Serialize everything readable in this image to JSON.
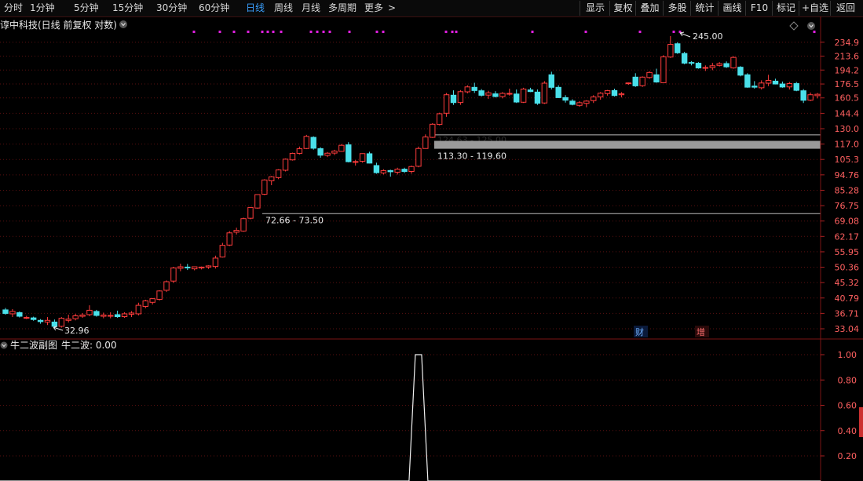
{
  "toolbar": {
    "periods": [
      "分时",
      "1分钟",
      "5分钟",
      "15分钟",
      "30分钟",
      "60分钟",
      "日线",
      "周线",
      "月线",
      "多周期",
      "更多"
    ],
    "active_period": "日线",
    "more_arrow": ">",
    "right_buttons": [
      "显示",
      "复权",
      "叠加",
      "多股",
      "统计",
      "画线",
      "F10",
      "标记",
      "+自选",
      "返回"
    ]
  },
  "main_panel": {
    "title": "谆中科技(日线 前复权 对数)",
    "high_label": "245.00",
    "low_label": "32.96",
    "event_badges": [
      "财",
      "增"
    ],
    "price_ticks": [
      "234.9",
      "213.6",
      "194.2",
      "176.5",
      "160.5",
      "144.4",
      "130.0",
      "117.0",
      "105.3",
      "94.76",
      "85.28",
      "76.75",
      "69.08",
      "62.17",
      "55.95",
      "50.36",
      "45.32",
      "40.79",
      "36.71",
      "33.04"
    ],
    "zones": [
      {
        "label": "124.63 - 125.00"
      },
      {
        "label": "113.30 - 119.60"
      },
      {
        "label": "72.66 - 73.50"
      }
    ]
  },
  "sub_panel": {
    "title": "牛二波副图",
    "indicator_label": "牛二波: 0.00",
    "ticks": [
      "1.00",
      "0.80",
      "0.60",
      "0.40",
      "0.20"
    ]
  },
  "colors": {
    "up": "#ff3c3c",
    "down": "#4ae0ea",
    "grid": "#5a1010",
    "accent": "#3aa0ff",
    "marker": "#e020e0"
  },
  "chart_data": {
    "type": "candlestick",
    "scale": "log",
    "ylim": [
      33.04,
      245.0
    ],
    "candles": [
      [
        37.6,
        38.1,
        36.4,
        36.7
      ],
      [
        36.6,
        37.8,
        35.8,
        37.2
      ],
      [
        36.9,
        37.2,
        35.7,
        36.0
      ],
      [
        35.6,
        36.1,
        35.3,
        35.7
      ],
      [
        35.6,
        35.9,
        34.9,
        35.2
      ],
      [
        35.0,
        35.3,
        34.2,
        34.7
      ],
      [
        34.6,
        35.8,
        33.9,
        35.0
      ],
      [
        34.6,
        35.2,
        32.96,
        33.6
      ],
      [
        33.6,
        35.8,
        33.3,
        35.5
      ],
      [
        35.0,
        36.4,
        34.5,
        35.3
      ],
      [
        35.4,
        36.6,
        35.0,
        36.1
      ],
      [
        36.0,
        36.8,
        35.6,
        36.3
      ],
      [
        36.4,
        38.8,
        36.0,
        37.5
      ],
      [
        37.2,
        37.6,
        35.9,
        36.2
      ],
      [
        36.0,
        36.9,
        35.5,
        36.3
      ],
      [
        36.1,
        37.0,
        35.5,
        36.2
      ],
      [
        36.4,
        37.4,
        35.6,
        35.9
      ],
      [
        35.9,
        37.0,
        35.6,
        36.6
      ],
      [
        36.5,
        37.3,
        35.8,
        36.8
      ],
      [
        36.6,
        39.5,
        36.2,
        38.8
      ],
      [
        38.5,
        40.3,
        38.0,
        40.0
      ],
      [
        39.6,
        40.7,
        39.0,
        40.6
      ],
      [
        40.4,
        43.0,
        40.1,
        42.8
      ],
      [
        43.0,
        46.0,
        42.5,
        45.6
      ],
      [
        45.8,
        50.5,
        45.2,
        50.1
      ],
      [
        50.0,
        51.6,
        49.0,
        50.5
      ],
      [
        50.4,
        51.5,
        49.4,
        50.2
      ],
      [
        49.8,
        50.6,
        49.3,
        50.5
      ],
      [
        50.1,
        50.6,
        49.6,
        50.4
      ],
      [
        50.4,
        51.0,
        49.8,
        50.8
      ],
      [
        50.6,
        54.5,
        49.9,
        53.6
      ],
      [
        54.0,
        59.5,
        53.8,
        58.5
      ],
      [
        58.6,
        64.5,
        58.2,
        63.7
      ],
      [
        64.0,
        66.0,
        63.0,
        64.8
      ],
      [
        64.5,
        70.7,
        64.2,
        70.2
      ],
      [
        70.4,
        76.0,
        69.9,
        75.8
      ],
      [
        75.5,
        83.0,
        75.2,
        82.8
      ],
      [
        83.0,
        92.0,
        82.5,
        91.5
      ],
      [
        91.0,
        94.0,
        88.3,
        93.5
      ],
      [
        93.0,
        98.5,
        92.0,
        98.0
      ],
      [
        97.8,
        106.0,
        97.0,
        105.5
      ],
      [
        105.0,
        110.3,
        104.5,
        109.8
      ],
      [
        109.8,
        115.0,
        109.0,
        113.3
      ],
      [
        113.5,
        124.6,
        113.0,
        123.3
      ],
      [
        122.5,
        123.4,
        112.6,
        113.7
      ],
      [
        113.4,
        114.5,
        106.5,
        108.4
      ],
      [
        108.3,
        110.8,
        107.0,
        109.9
      ],
      [
        110.0,
        112.5,
        108.5,
        111.5
      ],
      [
        111.3,
        117.0,
        111.0,
        116.0
      ],
      [
        116.4,
        118.5,
        103.2,
        103.7
      ],
      [
        103.6,
        104.9,
        101.0,
        103.8
      ],
      [
        104.0,
        109.8,
        103.0,
        109.6
      ],
      [
        109.5,
        111.0,
        102.5,
        102.7
      ],
      [
        101.0,
        103.0,
        95.5,
        96.2
      ],
      [
        96.0,
        98.5,
        95.0,
        97.5
      ],
      [
        97.6,
        98.2,
        93.6,
        96.8
      ],
      [
        96.5,
        99.5,
        95.0,
        98.5
      ],
      [
        98.5,
        99.5,
        96.0,
        97.0
      ],
      [
        97.0,
        101.0,
        95.5,
        100.3
      ],
      [
        100.5,
        115.0,
        99.8,
        113.5
      ],
      [
        113.5,
        125.0,
        113.3,
        122.8
      ],
      [
        122.5,
        135.0,
        122.0,
        134.0
      ],
      [
        133.8,
        145.0,
        133.0,
        144.0
      ],
      [
        144.5,
        166.0,
        141.0,
        164.0
      ],
      [
        163.5,
        169.0,
        153.0,
        155.4
      ],
      [
        155.5,
        169.3,
        153.0,
        167.5
      ],
      [
        167.3,
        175.0,
        165.5,
        173.0
      ],
      [
        172.5,
        178.0,
        166.0,
        168.8
      ],
      [
        168.5,
        170.5,
        162.0,
        163.4
      ],
      [
        163.6,
        168.5,
        159.5,
        166.1
      ],
      [
        165.0,
        168.0,
        161.0,
        162.0
      ],
      [
        162.0,
        167.0,
        160.0,
        165.5
      ],
      [
        165.0,
        171.0,
        163.0,
        165.5
      ],
      [
        164.8,
        170.0,
        155.0,
        156.0
      ],
      [
        155.8,
        172.0,
        155.0,
        170.5
      ],
      [
        169.5,
        172.0,
        167.0,
        167.6
      ],
      [
        167.0,
        170.0,
        153.0,
        154.7
      ],
      [
        155.0,
        180.0,
        154.0,
        177.5
      ],
      [
        188.0,
        192.0,
        170.0,
        172.5
      ],
      [
        172.5,
        175.0,
        160.5,
        160.8
      ],
      [
        160.8,
        163.5,
        155.4,
        158.0
      ],
      [
        157.0,
        159.0,
        152.5,
        153.5
      ],
      [
        152.5,
        157.0,
        151.0,
        155.3
      ],
      [
        154.6,
        158.0,
        150.5,
        157.0
      ],
      [
        157.5,
        163.5,
        155.0,
        161.5
      ],
      [
        161.5,
        167.0,
        158.5,
        165.7
      ],
      [
        165.3,
        169.5,
        163.0,
        168.6
      ],
      [
        168.8,
        171.0,
        162.0,
        163.1
      ],
      [
        164.0,
        167.0,
        161.0,
        165.0
      ],
      [
        177.5,
        178.3,
        175.5,
        177.8
      ],
      [
        185.0,
        190.0,
        173.0,
        174.3
      ],
      [
        174.5,
        186.0,
        173.0,
        185.0
      ],
      [
        184.5,
        192.5,
        183.0,
        191.0
      ],
      [
        188.0,
        196.0,
        178.0,
        178.9
      ],
      [
        178.0,
        215.0,
        177.5,
        212.5
      ],
      [
        212.3,
        245.0,
        211.0,
        231.5
      ],
      [
        232.5,
        235.0,
        217.0,
        218.5
      ],
      [
        217.5,
        220.0,
        202.0,
        203.6
      ],
      [
        204.5,
        206.5,
        200.5,
        203.7
      ],
      [
        203.5,
        205.0,
        196.0,
        197.0
      ],
      [
        197.0,
        200.5,
        193.0,
        197.6
      ],
      [
        197.5,
        204.0,
        194.0,
        200.0
      ],
      [
        200.5,
        205.0,
        199.0,
        202.8
      ],
      [
        203.0,
        206.0,
        197.0,
        198.5
      ],
      [
        197.0,
        213.5,
        196.0,
        211.7
      ],
      [
        198.0,
        199.5,
        186.0,
        187.5
      ],
      [
        188.0,
        190.0,
        172.0,
        172.7
      ],
      [
        174.0,
        180.0,
        171.0,
        172.7
      ],
      [
        172.0,
        181.0,
        170.0,
        177.7
      ],
      [
        177.5,
        188.0,
        174.0,
        180.8
      ],
      [
        180.0,
        183.0,
        176.0,
        176.5
      ],
      [
        176.5,
        179.5,
        172.0,
        172.9
      ],
      [
        173.0,
        179.0,
        170.0,
        177.0
      ],
      [
        177.0,
        179.0,
        168.0,
        169.0
      ],
      [
        168.5,
        170.5,
        155.0,
        157.9
      ],
      [
        158.0,
        166.5,
        157.0,
        164.0
      ],
      [
        163.0,
        166.0,
        160.0,
        164.5
      ]
    ],
    "second_wave_signal": {
      "x_index": 59,
      "value": 1.0
    }
  }
}
